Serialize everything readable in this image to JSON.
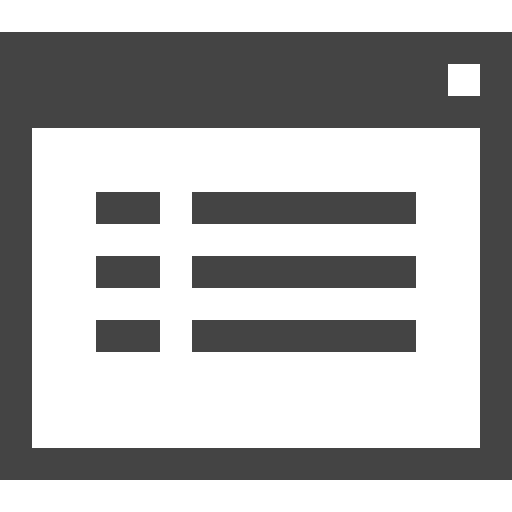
{
  "icon": {
    "name": "window-list-icon",
    "colors": {
      "foreground": "#444444",
      "background": "#ffffff"
    },
    "list_rows": 3
  }
}
